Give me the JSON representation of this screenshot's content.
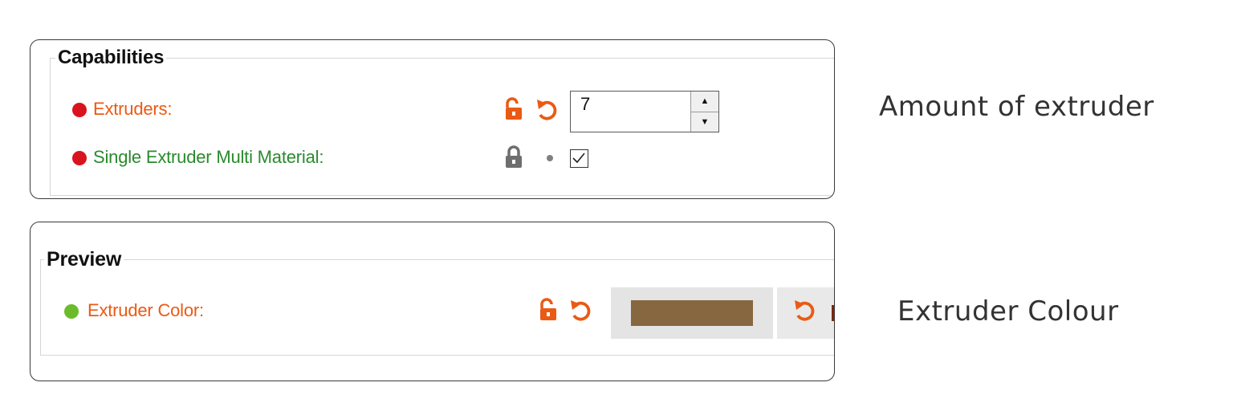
{
  "capabilities": {
    "title": "Capabilities",
    "extruders": {
      "label": "Extruders:",
      "value": "7"
    },
    "single_extruder_mm": {
      "label": "Single Extruder Multi Material:",
      "checked": true
    }
  },
  "preview": {
    "title": "Preview",
    "extruder_color": {
      "label": "Extruder Color:",
      "swatch_color": "#86673f"
    }
  },
  "annotations": {
    "amount": "Amount of extruder",
    "colour": "Extruder Colour"
  },
  "colors": {
    "orange_text": "#ea5a14",
    "green_text": "#2a8a2e",
    "red_dot": "#d8141e",
    "green_dot": "#6cbb2a"
  },
  "icons": {
    "unlocked": "unlocked-lock-icon",
    "locked": "locked-lock-icon",
    "undo": "undo-arrow-icon",
    "bullet": "gray-bullet-icon"
  }
}
